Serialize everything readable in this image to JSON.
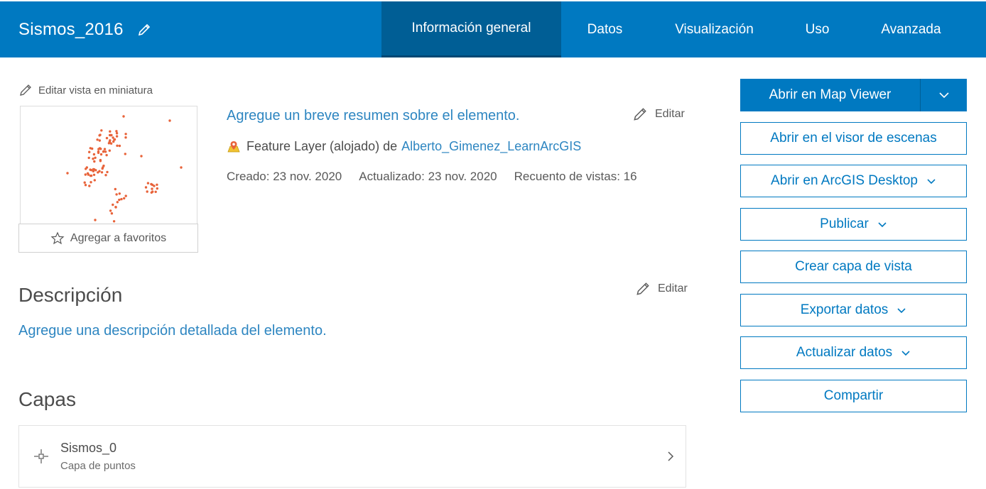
{
  "header": {
    "title": "Sismos_2016",
    "tabs": [
      {
        "label": "Información general",
        "active": true
      },
      {
        "label": "Datos",
        "active": false
      },
      {
        "label": "Visualización",
        "active": false
      },
      {
        "label": "Uso",
        "active": false
      },
      {
        "label": "Avanzada",
        "active": false
      }
    ]
  },
  "thumbnail": {
    "edit_label": "Editar vista en miniatura",
    "favorite_label": "Agregar a favoritos"
  },
  "summary": {
    "placeholder_link": "Agregue un breve resumen sobre el elemento.",
    "edit_label": "Editar",
    "item_type": "Feature Layer (alojado) de",
    "owner": "Alberto_Gimenez_LearnArcGIS",
    "created": "Creado: 23 nov. 2020",
    "updated": "Actualizado: 23 nov. 2020",
    "views": "Recuento de vistas: 16"
  },
  "description": {
    "title": "Descripción",
    "edit_label": "Editar",
    "placeholder_link": "Agregue una descripción detallada del elemento."
  },
  "layers": {
    "title": "Capas",
    "items": [
      {
        "name": "Sismos_0",
        "type": "Capa de puntos"
      }
    ]
  },
  "actions": {
    "primary": "Abrir en Map Viewer",
    "buttons": [
      {
        "label": "Abrir en el visor de escenas",
        "dropdown": false
      },
      {
        "label": "Abrir en ArcGIS Desktop",
        "dropdown": true
      },
      {
        "label": "Publicar",
        "dropdown": true
      },
      {
        "label": "Crear capa de vista",
        "dropdown": false
      },
      {
        "label": "Exportar datos",
        "dropdown": true
      },
      {
        "label": "Actualizar datos",
        "dropdown": true
      },
      {
        "label": "Compartir",
        "dropdown": false
      }
    ]
  },
  "colors": {
    "header_bg": "#0079c1",
    "active_tab_bg": "#005e95",
    "link": "#2e86c1",
    "thumbnail_points": "#e8633a"
  },
  "icons": {
    "title_edit": "pencil-icon",
    "layer_type": "feature-layer-icon",
    "favorite": "star-icon",
    "point_layer": "point-layer-icon",
    "row_chevron": "chevron-right-icon",
    "dropdown": "chevron-down-icon"
  }
}
